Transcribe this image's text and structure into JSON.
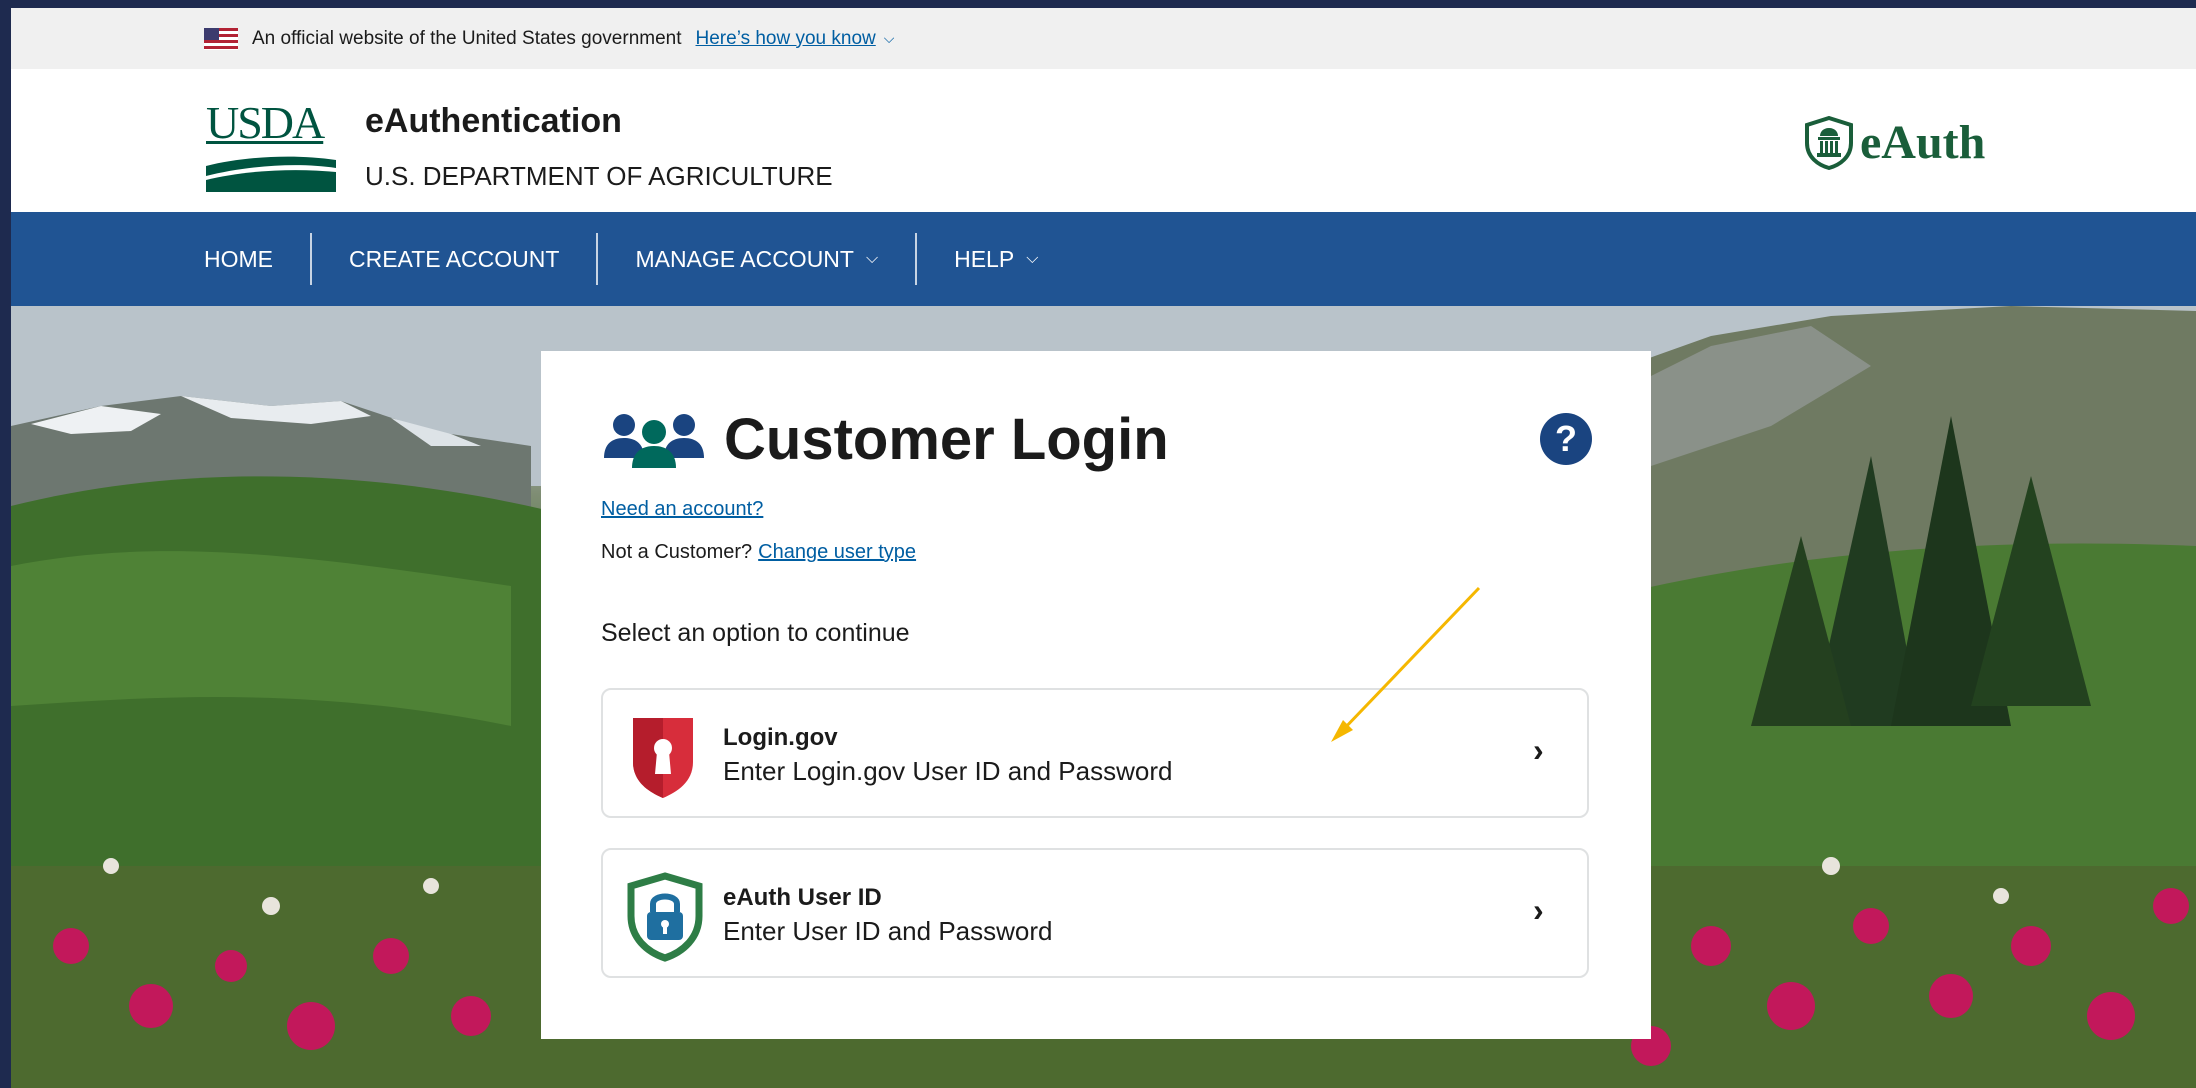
{
  "gov_banner": {
    "text": "An official website of the United States government",
    "link": "Here’s how you know"
  },
  "header": {
    "usda_logo_text": "USDA",
    "title": "eAuthentication",
    "subtitle": "U.S. DEPARTMENT OF AGRICULTURE",
    "brand_logo": "eAuth"
  },
  "nav": {
    "items": [
      {
        "label": "HOME"
      },
      {
        "label": "CREATE ACCOUNT"
      },
      {
        "label": "MANAGE ACCOUNT"
      },
      {
        "label": "HELP"
      }
    ]
  },
  "card": {
    "title": "Customer Login",
    "help_icon": "?",
    "need_account_link": "Need an account?",
    "not_customer_text": "Not a Customer?",
    "change_user_type_link": "Change user type",
    "select_prompt": "Select an option to continue",
    "options": [
      {
        "title": "Login.gov",
        "desc": "Enter Login.gov User ID and Password",
        "icon": "login-gov-shield-icon"
      },
      {
        "title": "eAuth User ID",
        "desc": "Enter User ID and Password",
        "icon": "eauth-lock-shield-icon"
      }
    ]
  },
  "colors": {
    "nav_bg": "#205493",
    "link": "#005ea2",
    "help_bg": "#1a4480",
    "logingov_red": "#d72d3b",
    "eauth_green": "#2e7d46",
    "eauth_blue": "#1f6fa0",
    "annotation_arrow": "#f5b700"
  }
}
